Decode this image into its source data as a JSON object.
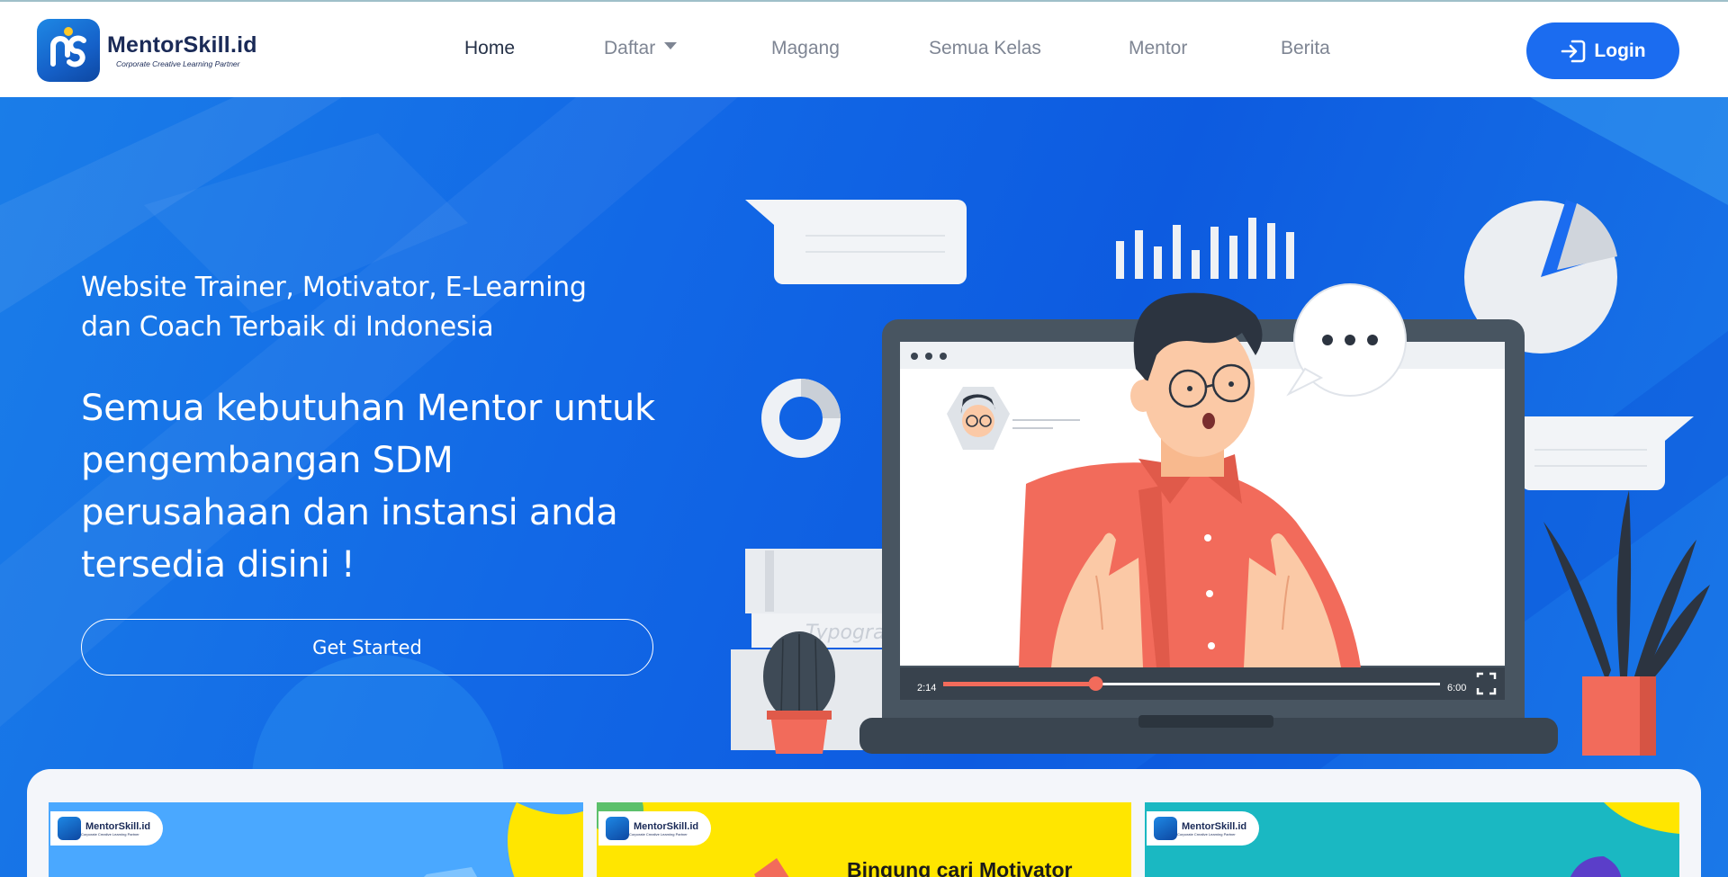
{
  "brand": {
    "name": "MentorSkill.id",
    "tagline": "Corporate Creative Learning Partner"
  },
  "nav": {
    "items": [
      {
        "label": "Home",
        "active": true
      },
      {
        "label": "Daftar",
        "dropdown": true
      },
      {
        "label": "Magang"
      },
      {
        "label": "Semua Kelas"
      },
      {
        "label": "Mentor"
      },
      {
        "label": "Berita"
      }
    ],
    "login_label": "Login"
  },
  "hero": {
    "subtitle": "Website Trainer, Motivator, E-Learning dan Coach Terbaik di Indonesia",
    "headline": "Semua kebutuhan Mentor untuk pengembangan SDM perusahaan dan instansi anda tersedia disini !",
    "cta_label": "Get Started",
    "video": {
      "elapsed": "2:14",
      "duration": "6:00",
      "progress": 0.307
    },
    "books_text": "Typogra"
  },
  "cards": [
    {
      "badge": "MentorSkill.id",
      "badge_tag": "Corporate Creative Learning Partner",
      "headline": ""
    },
    {
      "badge": "MentorSkill.id",
      "badge_tag": "Corporate Creative Learning Partner",
      "headline": "Bingung cari Motivator"
    },
    {
      "badge": "MentorSkill.id",
      "badge_tag": "Corporate Creative Learning Partner",
      "headline": ""
    }
  ],
  "colors": {
    "primary": "#1b6cf0",
    "brand_navy": "#1a2a57",
    "nav_text": "#7e8593",
    "shirt": "#f26b5b",
    "card1_bg": "#4aa8ff",
    "card2_bg": "#ffe600",
    "card3_bg": "#1ab8c2"
  },
  "icons": {
    "login": "login-arrow-icon",
    "dropdown": "caret-down-icon",
    "fullscreen": "fullscreen-icon",
    "more": "ellipsis-icon"
  }
}
